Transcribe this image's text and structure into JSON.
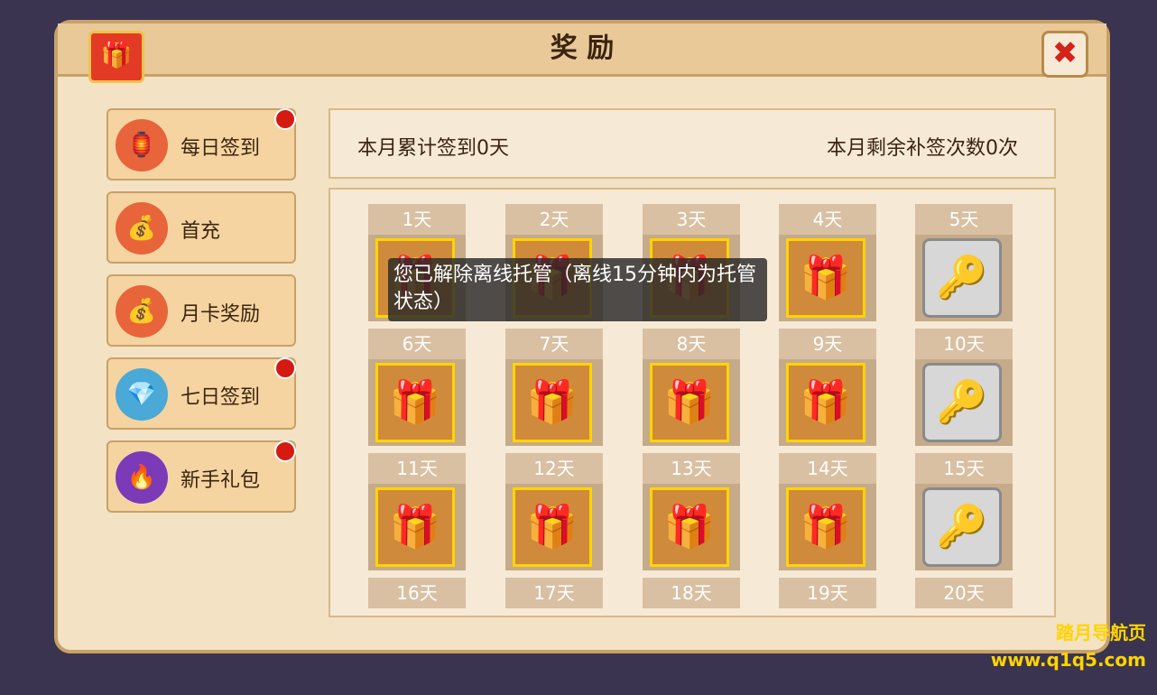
{
  "title": "奖 励",
  "close": "✖",
  "nav": [
    {
      "label": "每日签到",
      "icon": "🏮",
      "dot": true
    },
    {
      "label": "首充",
      "icon": "💰",
      "dot": false
    },
    {
      "label": "月卡奖励",
      "icon": "💰",
      "dot": false
    },
    {
      "label": "七日签到",
      "icon": "💎",
      "dot": true
    },
    {
      "label": "新手礼包",
      "icon": "🔥",
      "dot": true
    }
  ],
  "info": {
    "left": "本月累计签到0天",
    "right": "本月剩余补签次数0次"
  },
  "days": [
    "1天",
    "2天",
    "3天",
    "4天",
    "5天",
    "6天",
    "7天",
    "8天",
    "9天",
    "10天",
    "11天",
    "12天",
    "13天",
    "14天",
    "15天",
    "16天",
    "17天",
    "18天",
    "19天",
    "20天"
  ],
  "toast": "您已解除离线托管（离线15分钟内为托管状态）",
  "watermark": [
    "踏月导航页",
    "www.q1q5.com"
  ]
}
